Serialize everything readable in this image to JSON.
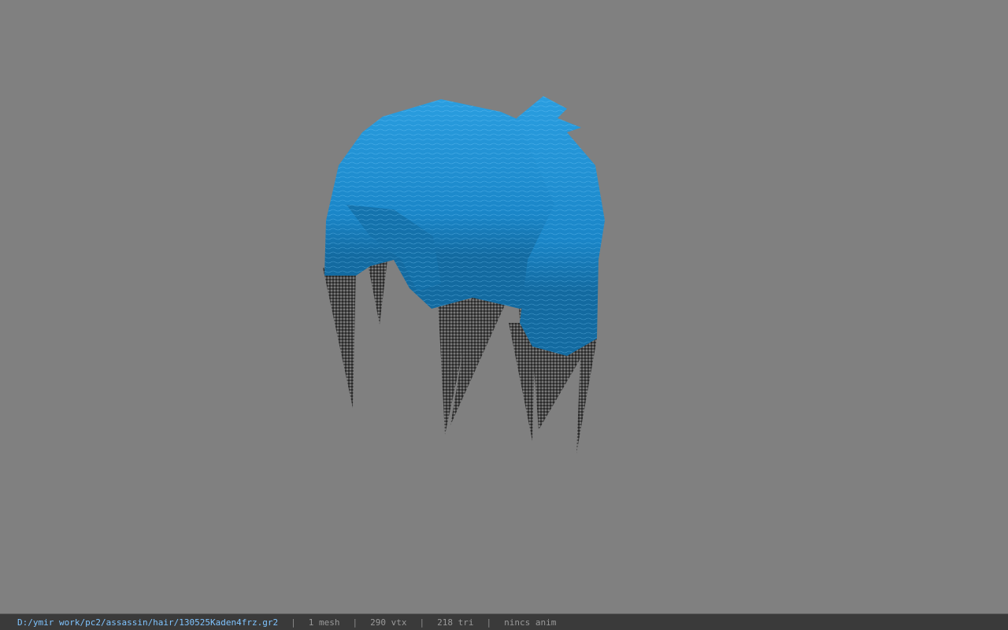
{
  "viewport": {
    "background_color": "#808080",
    "model_name": "blue-spiky-hair-mesh",
    "hair_color": "#1f8fd0",
    "tip_color": "#4a4a4a"
  },
  "statusbar": {
    "file_path": "D:/ymir work/pc2/assassin/hair/130525Kaden4frz.gr2",
    "separator": "|",
    "mesh_count": "1 mesh",
    "vertex_count": "290 vtx",
    "triangle_count": "218 tri",
    "anim_status": "nincs anim",
    "path_color": "#7fc4ff",
    "background_color": "#3a3a3a"
  }
}
